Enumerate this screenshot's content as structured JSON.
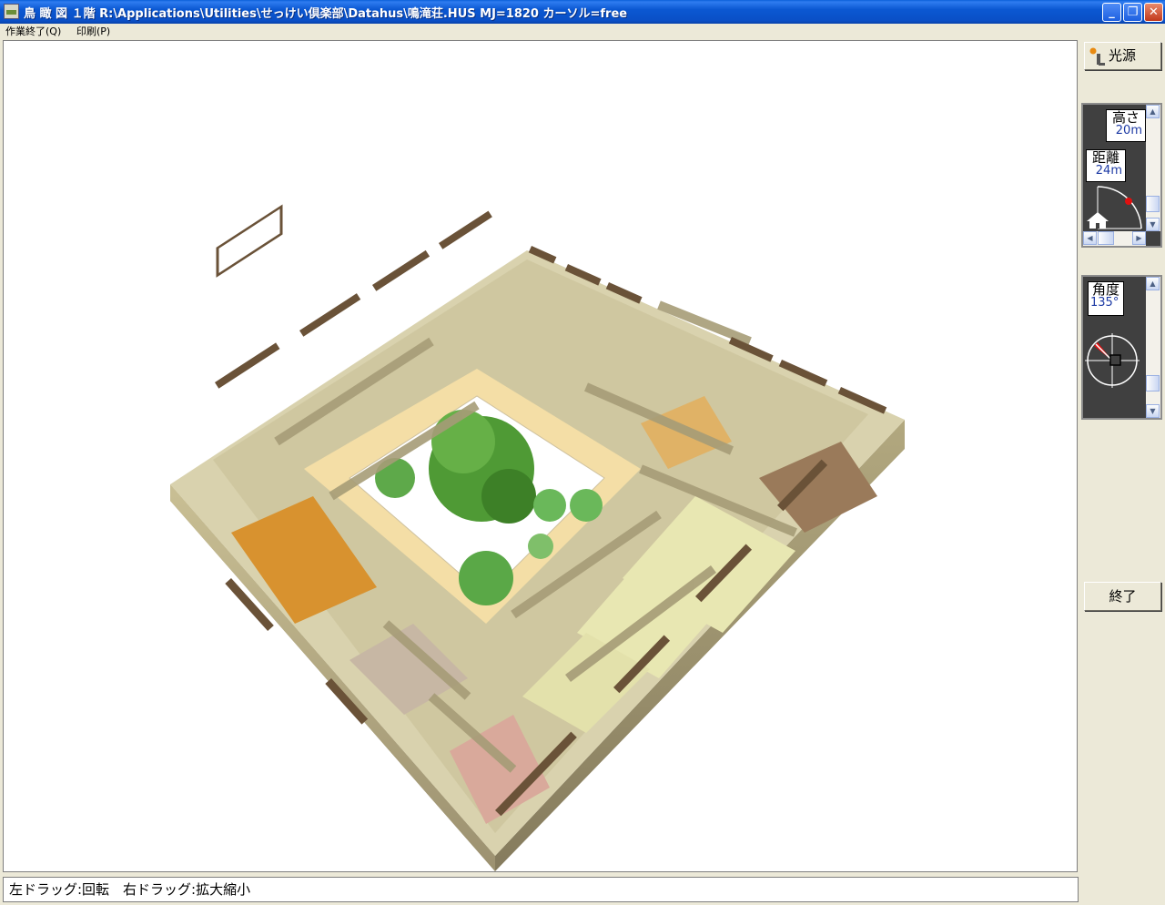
{
  "window": {
    "title": "鳥 瞰 図 １階  R:\\Applications\\Utilities\\せっけい倶楽部\\Datahus\\鳴滝荘.HUS  MJ=1820  カーソル=free",
    "minimize_glyph": "_",
    "restore_glyph": "❐",
    "close_glyph": "✕"
  },
  "menu": {
    "items": [
      {
        "label": "作業終了(Q)"
      },
      {
        "label": "印刷(P)"
      }
    ]
  },
  "viewport": {
    "description_icon": "isometric-house-render"
  },
  "status": {
    "text": "左ドラッグ:回転　右ドラッグ:拡大縮小"
  },
  "right_panel": {
    "light_button": {
      "label": "光源",
      "icon": "light-bulb-icon"
    },
    "height": {
      "label": "高さ",
      "value": "20m"
    },
    "distance": {
      "label": "距離",
      "value": "24m"
    },
    "angle": {
      "label": "角度",
      "value": "135°"
    },
    "end_button": {
      "label": "終了"
    }
  },
  "colors": {
    "titlebar": "#0a4fc6",
    "panel_bg": "#404040",
    "value_text": "#1d3aa4",
    "indicator_red": "#e01010"
  }
}
